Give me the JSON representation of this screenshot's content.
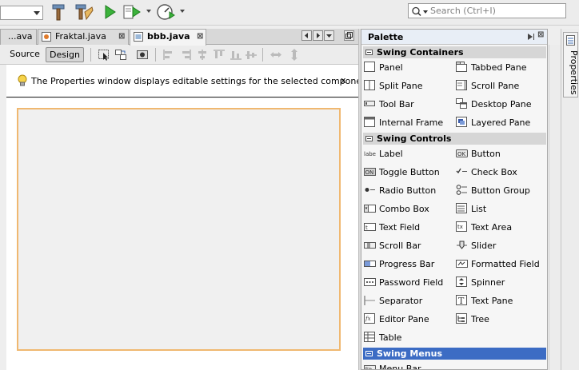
{
  "toolbar": {
    "icons": [
      "build-hammer-icon",
      "clean-build-icon",
      "run-icon",
      "debug-icon",
      "profile-icon"
    ],
    "search_placeholder": "Search (Ctrl+I)"
  },
  "editor_tabs": [
    {
      "label": "...ava",
      "active": false
    },
    {
      "label": "Fraktal.java",
      "active": false
    },
    {
      "label": "bbb.java",
      "active": true
    }
  ],
  "design_bar": {
    "source_label": "Source",
    "design_label": "Design"
  },
  "info_banner": {
    "text": "The Properties window displays editable settings for the selected components.",
    "close_label": "x"
  },
  "palette": {
    "title": "Palette",
    "categories": [
      {
        "name": "Swing Containers",
        "selected": false,
        "items": [
          {
            "label": "Panel",
            "icon": "panel-icon"
          },
          {
            "label": "Tabbed Pane",
            "icon": "tabbed-pane-icon"
          },
          {
            "label": "Split Pane",
            "icon": "split-pane-icon"
          },
          {
            "label": "Scroll Pane",
            "icon": "scroll-pane-icon"
          },
          {
            "label": "Tool Bar",
            "icon": "tool-bar-icon"
          },
          {
            "label": "Desktop Pane",
            "icon": "desktop-pane-icon"
          },
          {
            "label": "Internal Frame",
            "icon": "internal-frame-icon"
          },
          {
            "label": "Layered Pane",
            "icon": "layered-pane-icon"
          }
        ]
      },
      {
        "name": "Swing Controls",
        "selected": false,
        "items": [
          {
            "label": "Label",
            "icon": "label-icon"
          },
          {
            "label": "Button",
            "icon": "button-icon"
          },
          {
            "label": "Toggle Button",
            "icon": "toggle-button-icon"
          },
          {
            "label": "Check Box",
            "icon": "check-box-icon"
          },
          {
            "label": "Radio Button",
            "icon": "radio-button-icon"
          },
          {
            "label": "Button Group",
            "icon": "button-group-icon"
          },
          {
            "label": "Combo Box",
            "icon": "combo-box-icon"
          },
          {
            "label": "List",
            "icon": "list-icon"
          },
          {
            "label": "Text Field",
            "icon": "text-field-icon"
          },
          {
            "label": "Text Area",
            "icon": "text-area-icon"
          },
          {
            "label": "Scroll Bar",
            "icon": "scroll-bar-icon"
          },
          {
            "label": "Slider",
            "icon": "slider-icon"
          },
          {
            "label": "Progress Bar",
            "icon": "progress-bar-icon"
          },
          {
            "label": "Formatted Field",
            "icon": "formatted-field-icon"
          },
          {
            "label": "Password Field",
            "icon": "password-field-icon"
          },
          {
            "label": "Spinner",
            "icon": "spinner-icon"
          },
          {
            "label": "Separator",
            "icon": "separator-icon"
          },
          {
            "label": "Text Pane",
            "icon": "text-pane-icon"
          },
          {
            "label": "Editor Pane",
            "icon": "editor-pane-icon"
          },
          {
            "label": "Tree",
            "icon": "tree-icon"
          },
          {
            "label": "Table",
            "icon": "table-icon"
          }
        ]
      },
      {
        "name": "Swing Menus",
        "selected": true,
        "items": [
          {
            "label": "Menu Bar",
            "icon": "menu-bar-icon"
          }
        ]
      }
    ],
    "icon_text": {
      "label": "label",
      "button": "OK",
      "toggle": "ON",
      "textarea": "tx",
      "textfield": "t",
      "editor": "fx"
    }
  },
  "properties_tab": {
    "label": "Properties"
  },
  "colors": {
    "selected_category": "#3c6cc4",
    "form_border": "#f0b870"
  }
}
